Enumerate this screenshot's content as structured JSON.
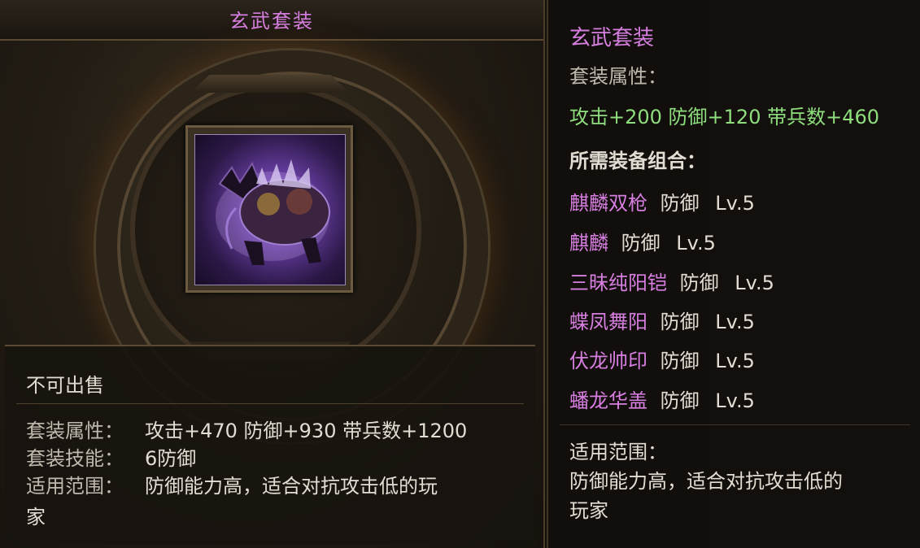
{
  "left_panel": {
    "title": "玄武套装",
    "not_sellable": "不可出售",
    "set_attr_label": "套装属性：",
    "set_attr_value": "攻击+470 防御+930 带兵数+1200",
    "set_skill_label": "套装技能：",
    "set_skill_value": "6防御",
    "scope_label": "适用范围：",
    "scope_value_line1": "防御能力高，适合对抗攻击低的玩",
    "scope_value_line2": "家",
    "item_icon": "purple-dragon-turtle-icon"
  },
  "tooltip": {
    "name": "玄武套装",
    "set_attr_label": "套装属性：",
    "set_attr_value": "攻击+200 防御+120 带兵数+460",
    "required_label": "所需装备组合：",
    "items": [
      {
        "name": "麒麟双枪",
        "type": "防御",
        "level": "Lv.5"
      },
      {
        "name": "麒麟",
        "type": "防御",
        "level": "Lv.5"
      },
      {
        "name": "三昧纯阳铠",
        "type": "防御",
        "level": "Lv.5"
      },
      {
        "name": "蝶凤舞阳",
        "type": "防御",
        "level": "Lv.5"
      },
      {
        "name": "伏龙帅印",
        "type": "防御",
        "level": "Lv.5"
      },
      {
        "name": "蟠龙华盖",
        "type": "防御",
        "level": "Lv.5"
      }
    ],
    "scope_label": "适用范围：",
    "scope_line1": "防御能力高，适合对抗攻击低的",
    "scope_line2": "玩家"
  },
  "colors": {
    "purple": "#d77fe0",
    "green": "#8ede7e",
    "text": "#e2ddd2"
  }
}
